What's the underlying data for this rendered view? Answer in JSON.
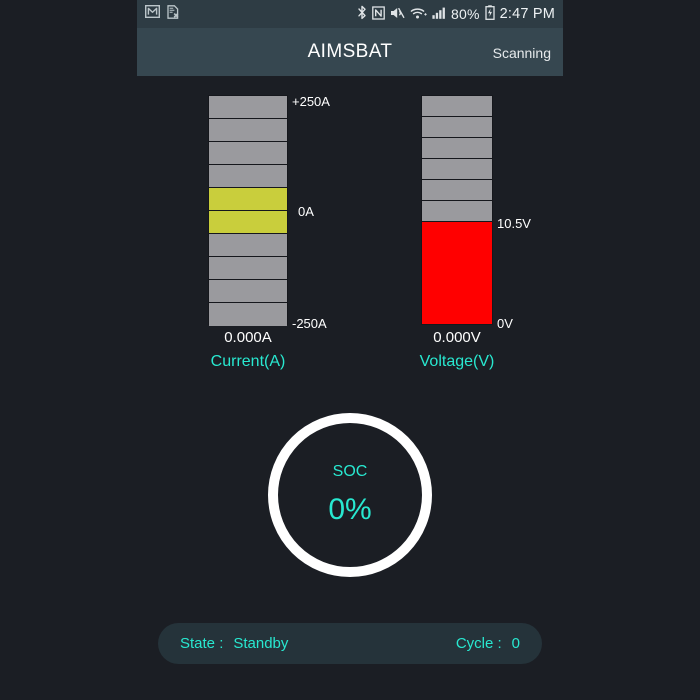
{
  "statusbar": {
    "left_icons": [
      {
        "name": "gmail-icon",
        "label": "Gmail"
      },
      {
        "name": "document-error-icon",
        "label": "Document error"
      }
    ],
    "right_icons": [
      {
        "name": "bluetooth-icon",
        "label": "Bluetooth"
      },
      {
        "name": "nfc-icon",
        "label": "NFC"
      },
      {
        "name": "mute-icon",
        "label": "Sound muted"
      },
      {
        "name": "wifi-icon",
        "label": "Wi-Fi"
      },
      {
        "name": "cellular-signal-icon",
        "label": "Cellular signal"
      }
    ],
    "battery_percent": "80%",
    "battery_icon": "battery-charging-icon",
    "clock": "2:47 PM"
  },
  "titlebar": {
    "app_title": "AIMSBAT",
    "connection_status": "Scanning"
  },
  "gauges": {
    "current": {
      "label": "Current(A)",
      "readout": "0.000A",
      "tick_top": "+250A",
      "tick_mid": "0A",
      "tick_bottom": "-250A",
      "segment_count": 10,
      "active_segments": [
        5,
        6
      ],
      "active_color": "#c9ce3c",
      "inactive_color": "#9a9a9e"
    },
    "voltage": {
      "label": "Voltage(V)",
      "readout": "0.000V",
      "tick_mid": "10.5V",
      "tick_bottom": "0V",
      "segment_count": 6,
      "fill_percent": 44,
      "fill_color": "#ff0000",
      "inactive_color": "#9a9a9e"
    }
  },
  "soc": {
    "caption": "SOC",
    "value": "0%",
    "ring_color": "#ffffff",
    "text_color": "#28e8d0"
  },
  "bottom": {
    "state_key": "State :",
    "state_value": "Standby",
    "cycle_key": "Cycle :",
    "cycle_value": "0"
  },
  "theme": {
    "background": "#1b1e24",
    "statusbar_bg": "#2e3c44",
    "titlebar_bg": "#364750",
    "accent": "#28e8d0"
  }
}
